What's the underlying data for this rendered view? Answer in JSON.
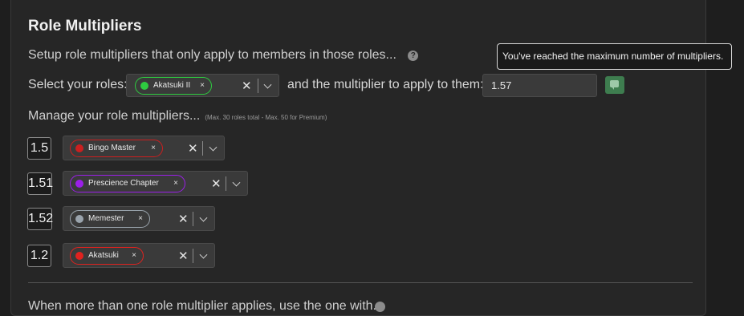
{
  "section": {
    "title": "Role Multipliers",
    "description": "Setup role multipliers that only apply to members in those roles...",
    "help_glyph": "?"
  },
  "tooltip": {
    "text": "You've reached the maximum number of multipliers."
  },
  "add_form": {
    "select_label": "Select your roles:",
    "selected_role": {
      "name": "Akatsuki II",
      "color": "#2ecc40"
    },
    "multiplier_label": "and the multiplier to apply to them:",
    "multiplier_value": "1.57",
    "add_icon": "add-comment-icon"
  },
  "manage": {
    "label": "Manage your role multipliers...",
    "note": "(Max. 30 roles total - Max. 50 for Premium)"
  },
  "multipliers": [
    {
      "value": "1.5",
      "role": "Bingo Master",
      "color": "#cc1f1f"
    },
    {
      "value": "1.51",
      "role": "Prescience Chapter",
      "color": "#9b1fe8"
    },
    {
      "value": "1.52",
      "role": "Memester",
      "color": "#9aa4ad"
    },
    {
      "value": "1.2",
      "role": "Akatsuki",
      "color": "#e0221f"
    }
  ],
  "footer": {
    "text": "When more than one role multiplier applies, use the one with..."
  },
  "glyphs": {
    "remove": "×",
    "clear": "✕"
  }
}
